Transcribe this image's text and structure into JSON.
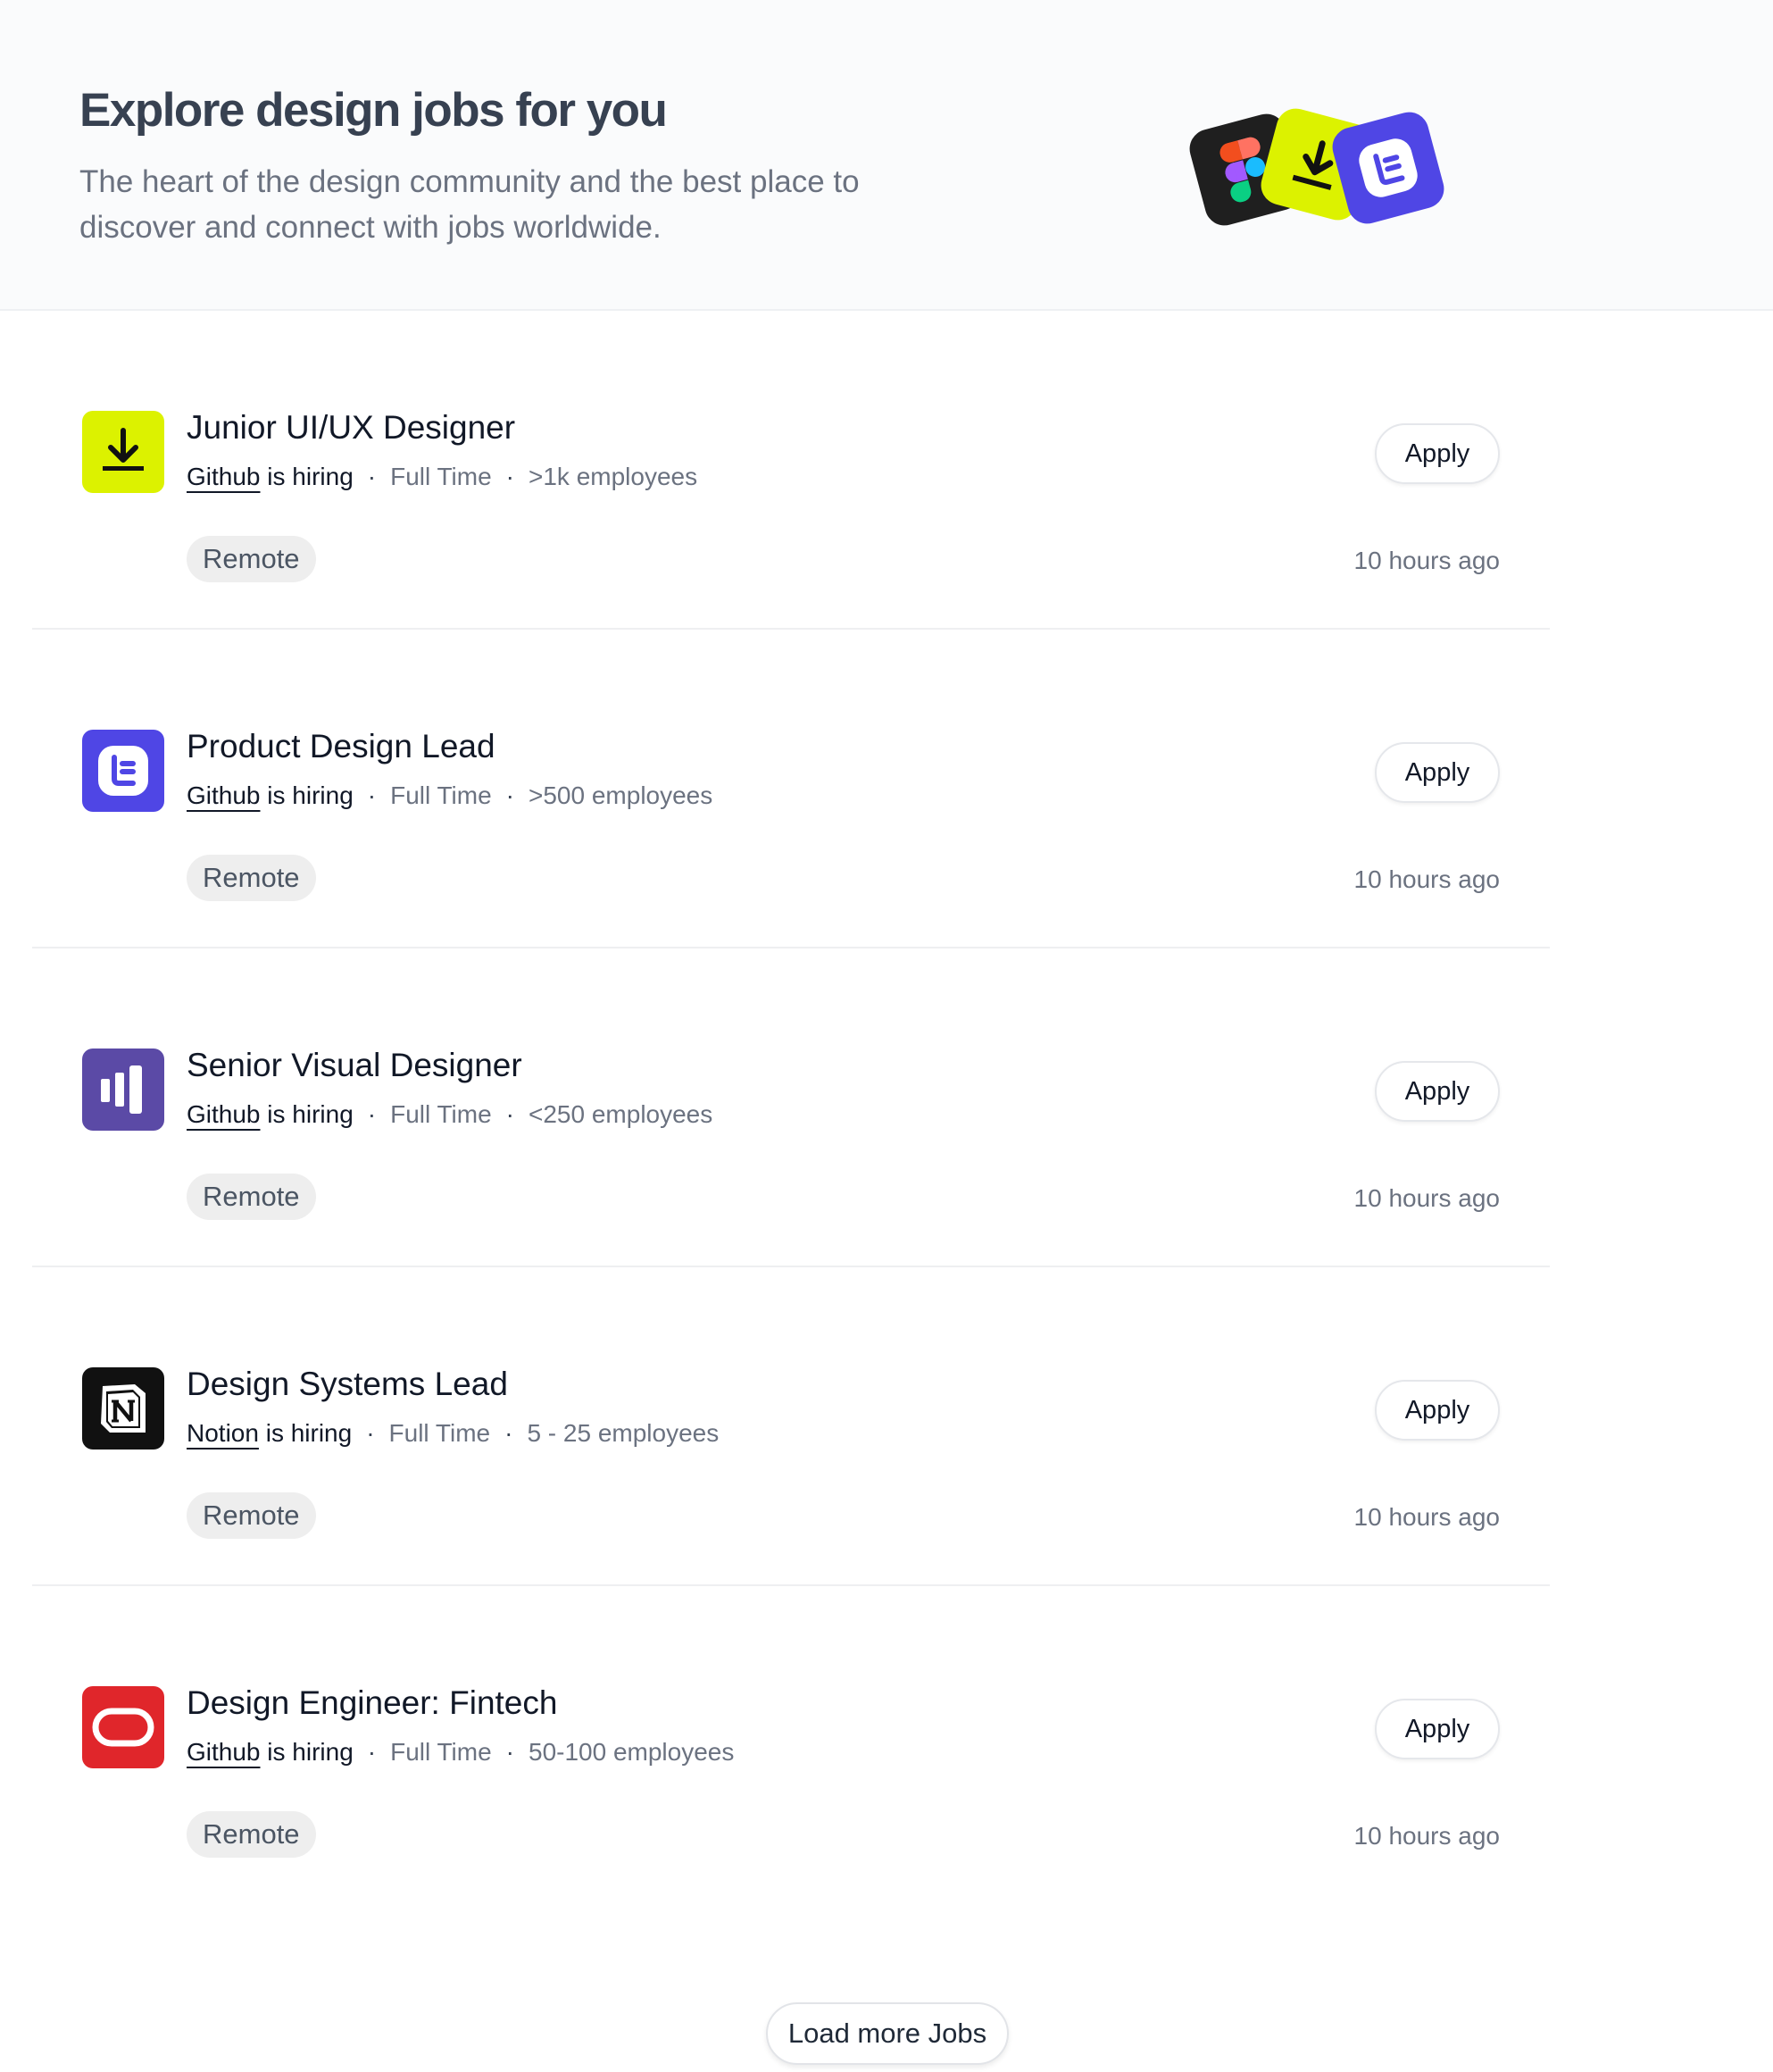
{
  "header": {
    "title": "Explore design jobs for you",
    "subtitle": "The heart of the design community and the best place to discover and connect with jobs worldwide.",
    "logos": [
      "figma-icon",
      "download-icon",
      "e-letter-icon"
    ]
  },
  "jobs": [
    {
      "title": "Junior UI/UX Designer",
      "company": "Github",
      "hiring_suffix": "is hiring",
      "employment": "Full Time",
      "size": ">1k employees",
      "tag": "Remote",
      "apply_label": "Apply",
      "posted": "10 hours ago",
      "logo_icon": "download-icon",
      "logo_color": "#dcf200"
    },
    {
      "title": "Product Design Lead",
      "company": "Github",
      "hiring_suffix": "is hiring",
      "employment": "Full Time",
      "size": ">500 employees",
      "tag": "Remote",
      "apply_label": "Apply",
      "posted": "10 hours ago",
      "logo_icon": "e-letter-icon",
      "logo_color": "#4f46e5"
    },
    {
      "title": "Senior Visual Designer",
      "company": "Github",
      "hiring_suffix": "is hiring",
      "employment": "Full Time",
      "size": "<250 employees",
      "tag": "Remote",
      "apply_label": "Apply",
      "posted": "10 hours ago",
      "logo_icon": "bars-icon",
      "logo_color": "#5b4aa6"
    },
    {
      "title": "Design Systems Lead",
      "company": "Notion",
      "hiring_suffix": "is hiring",
      "employment": "Full Time",
      "size": "5 - 25 employees",
      "tag": "Remote",
      "apply_label": "Apply",
      "posted": "10 hours ago",
      "logo_icon": "notion-icon",
      "logo_color": "#111111"
    },
    {
      "title": "Design Engineer: Fintech",
      "company": "Github",
      "hiring_suffix": "is hiring",
      "employment": "Full Time",
      "size": "50-100 employees",
      "tag": "Remote",
      "apply_label": "Apply",
      "posted": "10 hours ago",
      "logo_icon": "oracle-icon",
      "logo_color": "#e0262b"
    }
  ],
  "separator": "·",
  "load_more_label": "Load more Jobs"
}
